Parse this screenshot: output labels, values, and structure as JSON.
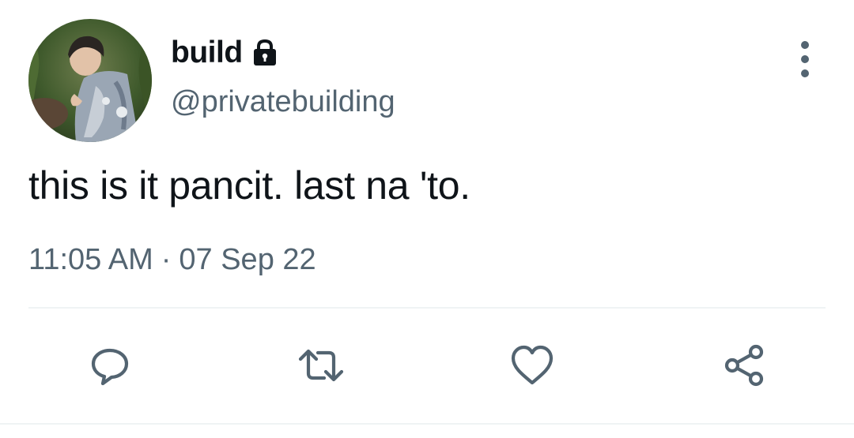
{
  "author": {
    "display_name": "build",
    "handle": "@privatebuilding",
    "protected_icon": "lock-icon",
    "avatar": "avatar-photo"
  },
  "tweet": {
    "text": "this is it pancit. last na 'to.",
    "time": "11:05 AM",
    "separator": "·",
    "date": "07 Sep 22"
  },
  "actions": {
    "reply_icon": "reply-icon",
    "retweet_icon": "retweet-icon",
    "like_icon": "heart-icon",
    "share_icon": "share-icon",
    "more_icon": "more-vertical-icon"
  },
  "colors": {
    "text_primary": "#0f1419",
    "text_secondary": "#536471",
    "divider": "#eff3f4"
  }
}
